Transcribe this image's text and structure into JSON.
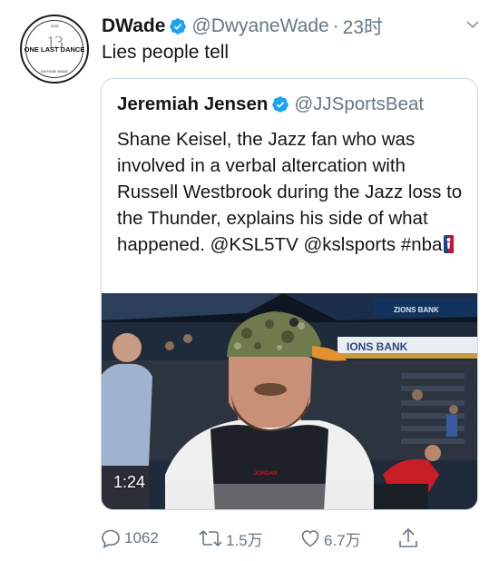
{
  "avatar": {
    "number": "13",
    "text": "ONE LAST DANCE",
    "ring_top": "2018",
    "ring_bottom": "DWYANE WADE"
  },
  "tweet": {
    "display_name": "DWade",
    "handle": "@DwyaneWade",
    "separator": "·",
    "time": "23时",
    "text": "Lies people tell"
  },
  "quoted": {
    "display_name": "Jeremiah Jensen",
    "handle": "@JJSportsBeat",
    "text": "Shane Keisel, the Jazz fan who was involved in a verbal altercation with Russell Westbrook during the Jazz loss to the Thunder, explains his side of what happened. @KSL5TV @kslsports #nba",
    "video": {
      "duration": "1:24",
      "banner_1": "ZIONS BANK",
      "banner_2": "IONS BANK",
      "shirt_text": "JORDAN"
    }
  },
  "actions": {
    "reply_count": "1062",
    "retweet_count": "1.5万",
    "like_count": "6.7万"
  },
  "colors": {
    "verified": "#1da1f2",
    "secondary_text": "#657786",
    "border": "#ccd6dd"
  },
  "icons": [
    "verified-badge-icon",
    "chevron-down-icon",
    "nba-logo-icon",
    "reply-icon",
    "retweet-icon",
    "like-icon",
    "share-icon"
  ]
}
